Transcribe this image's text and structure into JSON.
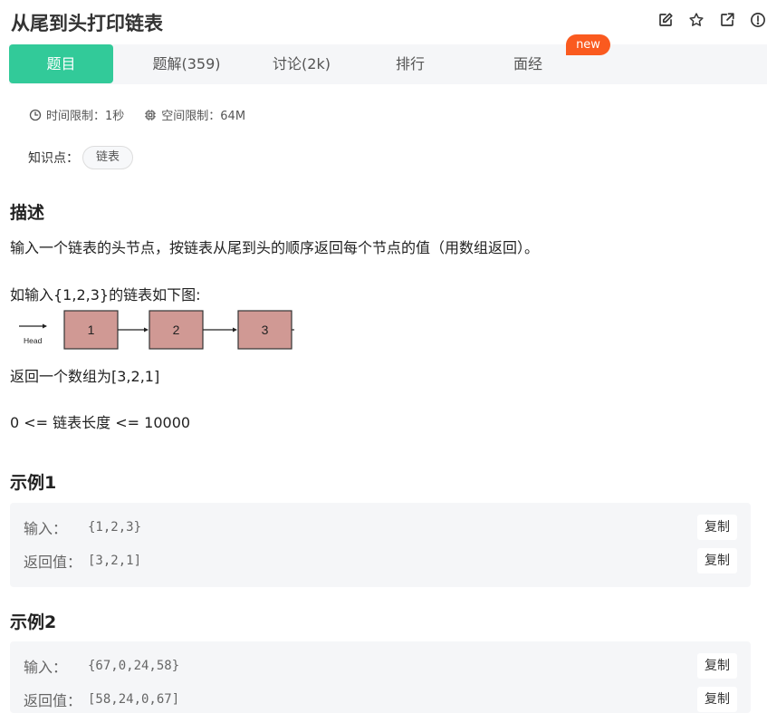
{
  "problem": {
    "title": "从尾到头打印链表"
  },
  "header_icons": [
    "edit-icon",
    "star-icon",
    "share-icon",
    "report-icon"
  ],
  "tabs": [
    {
      "label": "题目",
      "active": true
    },
    {
      "label": "题解(359)",
      "active": false
    },
    {
      "label": "讨论(2k)",
      "active": false
    },
    {
      "label": "排行",
      "active": false
    },
    {
      "label": "面经",
      "active": false
    }
  ],
  "new_badge": "new",
  "limits": {
    "time": "时间限制：1秒",
    "space": "空间限制：64M"
  },
  "knowledge": {
    "label": "知识点：",
    "tag": "链表"
  },
  "description": {
    "heading": "描述",
    "intro": "输入一个链表的头节点，按链表从尾到头的顺序返回每个节点的值（用数组返回）。",
    "example_intro": "如输入{1,2,3}的链表如下图:",
    "diagram": {
      "head_label": "Head",
      "nodes": [
        "1",
        "2",
        "3"
      ]
    },
    "result": "返回一个数组为[3,2,1]",
    "constraint": "0 <= 链表长度 <= 10000"
  },
  "examples": [
    {
      "heading": "示例1",
      "input_label": "输入：",
      "input": "{1,2,3}",
      "output_label": "返回值：",
      "output": "[3,2,1]",
      "copy_label": "复制"
    },
    {
      "heading": "示例2",
      "input_label": "输入：",
      "input": "{67,0,24,58}",
      "output_label": "返回值：",
      "output": "[58,24,0,67]",
      "copy_label": "复制"
    }
  ],
  "colors": {
    "accent": "#32ca99",
    "badge": "#fa5a1f",
    "node_fill": "#d09994"
  }
}
